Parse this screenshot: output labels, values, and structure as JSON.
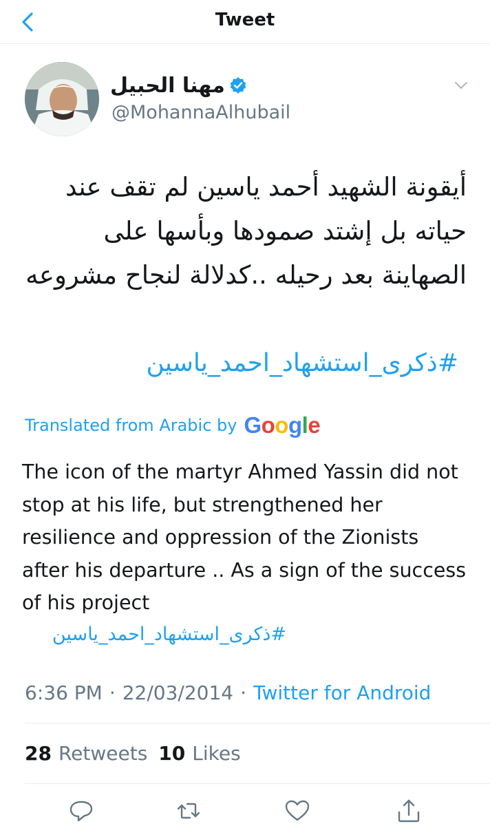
{
  "header": {
    "title": "Tweet"
  },
  "author": {
    "name": "مهنا الحبيل",
    "handle": "@MohannaAlhubail"
  },
  "tweet": {
    "text_ar": "أيقونة الشهيد أحمد ياسين لم تقف عند حياته بل إشتد صمودها وبأسها على الصهاينة بعد رحيله ..كدلالة لنجاح مشروعه",
    "hashtag_ar": "#ذكرى_استشهاد_احمد_ياسين",
    "translated_label": "Translated from Arabic by",
    "translation_provider": "Google",
    "translation": "The icon of the martyr Ahmed Yassin did not stop at his life, but strengthened her resilience and oppression of the Zionists after his departure .. As a sign of the success of his project",
    "translation_hashtag": "#ذكرى_استشهاد_احمد_ياسين",
    "time": "6:36 PM",
    "separator": "·",
    "date": "22/03/2014",
    "client": "Twitter for Android"
  },
  "stats": {
    "retweets_count": "28",
    "retweets_label": "Retweets",
    "likes_count": "10",
    "likes_label": "Likes"
  },
  "icons": {
    "back": "chevron-left-icon",
    "verified": "verified-badge-icon",
    "caret": "chevron-down-icon",
    "reply": "reply-icon",
    "retweet": "retweet-icon",
    "like": "heart-icon",
    "share": "share-icon"
  },
  "colors": {
    "accent": "#1da1f2",
    "text": "#14171a",
    "secondary": "#657786",
    "divider": "#e6ecf0"
  }
}
